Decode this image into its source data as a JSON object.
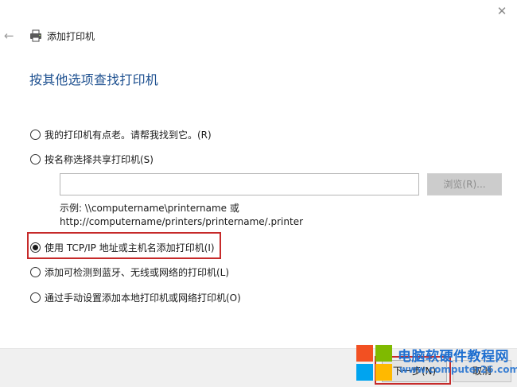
{
  "window": {
    "close_glyph": "✕",
    "back_glyph": "←",
    "title": "添加打印机"
  },
  "main": {
    "heading": "按其他选项查找打印机"
  },
  "options": [
    {
      "label": "我的打印机有点老。请帮我找到它。(R)",
      "selected": false
    },
    {
      "label": "按名称选择共享打印机(S)",
      "selected": false
    },
    {
      "label": "使用 TCP/IP 地址或主机名添加打印机(I)",
      "selected": true
    },
    {
      "label": "添加可检测到蓝牙、无线或网络的打印机(L)",
      "selected": false
    },
    {
      "label": "通过手动设置添加本地打印机或网络打印机(O)",
      "selected": false
    }
  ],
  "shared_printer": {
    "input_value": "",
    "browse_label": "浏览(R)...",
    "example_line1": "示例: \\\\computername\\printername 或",
    "example_line2": "http://computername/printers/printername/.printer"
  },
  "footer": {
    "next_label": "下一步(N)",
    "cancel_label": "取消"
  },
  "watermark": {
    "text": "电脑软硬件教程网",
    "url": "www.computer26.com"
  },
  "colors": {
    "heading": "#1c4f8f",
    "highlight": "#c62a2a",
    "watermark": "#1e6fd0"
  },
  "icons": {
    "close": "close-icon",
    "back": "back-arrow-icon",
    "printer": "printer-icon",
    "logo": "windows-logo-icon"
  }
}
